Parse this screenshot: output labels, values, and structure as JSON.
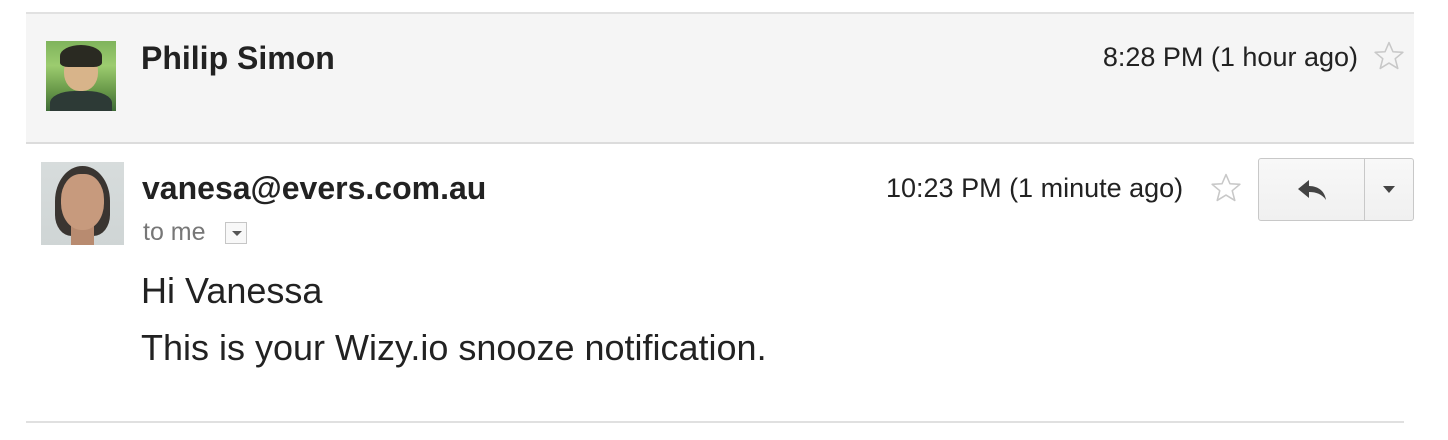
{
  "thread": {
    "collapsed_message": {
      "sender_name": "Philip Simon",
      "timestamp": "8:28 PM (1 hour ago)",
      "starred": false,
      "star_icon": "star-outline-icon"
    },
    "expanded_message": {
      "sender_email": "vanesa@evers.com.au",
      "recipient_label": "to me",
      "timestamp": "10:23 PM (1 minute ago)",
      "starred": false,
      "star_icon": "star-outline-icon",
      "reply_icon": "reply-arrow-icon",
      "more_icon": "chevron-down-icon",
      "body": {
        "greeting": "Hi Vanessa",
        "line": "This is your Wizy.io snooze notification."
      }
    }
  },
  "colors": {
    "collapsed_bg": "#f5f5f5",
    "star_outline": "#c8c8c8",
    "secondary_text": "#777777"
  }
}
